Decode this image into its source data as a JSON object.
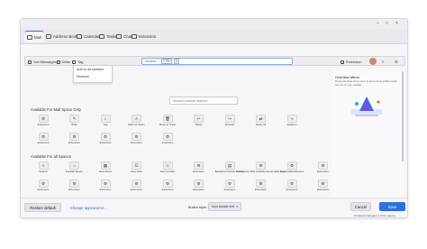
{
  "window_controls": [
    "–",
    "□",
    "×"
  ],
  "tabs": [
    {
      "label": "Mail",
      "icon": "mail-icon"
    },
    {
      "label": "Address Book",
      "icon": "address-book-icon"
    },
    {
      "label": "Calendar",
      "icon": "calendar-icon"
    },
    {
      "label": "Tasks",
      "icon": "tasks-icon"
    },
    {
      "label": "Chat",
      "icon": "chat-icon"
    },
    {
      "label": "Extension",
      "icon": "extension-icon"
    }
  ],
  "toolbar": {
    "get_messages": "Get Messages",
    "write": "Write",
    "tag": "Tag",
    "search_placeholder": "Search…",
    "shortcut_ctrl": "CTRL",
    "shortcut_key": "K",
    "extension": "Extension"
  },
  "context_menu": [
    "Add to all toolbars",
    "Remove"
  ],
  "palette": {
    "search_placeholder": "Search toolbar buttons…",
    "section_mail": "Available For Mail Space Only",
    "mail_row1": [
      {
        "label": "Extension",
        "glyph": "⚙"
      },
      {
        "label": "Write",
        "glyph": "✎"
      },
      {
        "label": "Tag",
        "glyph": "⌂"
      },
      {
        "label": "Mark as Spam",
        "glyph": "⚠"
      },
      {
        "label": "Move to Trash",
        "glyph": "🗑"
      },
      {
        "label": "Reply",
        "glyph": "↩"
      },
      {
        "label": "Forward",
        "glyph": "↪"
      },
      {
        "label": "Reply All",
        "glyph": "⇄"
      },
      {
        "label": "Redirect",
        "glyph": "⤷"
      }
    ],
    "mail_row2": [
      {
        "label": "Extension",
        "glyph": "⚙"
      },
      {
        "label": "Extension",
        "glyph": "⚙"
      },
      {
        "label": "Extension",
        "glyph": "⚙"
      },
      {
        "label": "Extension",
        "glyph": "⚙"
      },
      {
        "label": "Extension",
        "glyph": "⚙"
      }
    ],
    "section_all": "Available For all Spaces",
    "all_row1": [
      {
        "label": "Search",
        "glyph": "⌕"
      },
      {
        "label": "Parallel Space",
        "glyph": "⇔"
      },
      {
        "label": "New Event",
        "glyph": "▦"
      },
      {
        "label": "New Task",
        "glyph": "☑"
      },
      {
        "label": "New Contact",
        "glyph": "☺"
      },
      {
        "label": "Extension",
        "glyph": "⚙"
      },
      {
        "label": "Betterbird Simple Toolbar",
        "glyph": "▤"
      },
      {
        "label": "Summarize With A Mobile Email Hello Free",
        "glyph": "⚙"
      },
      {
        "label": "ExportAsPlusNames",
        "glyph": "⚙"
      },
      {
        "label": "Extension",
        "glyph": "⚙"
      }
    ],
    "all_row2": [
      {
        "label": "Extension",
        "glyph": "⚙"
      },
      {
        "label": "Extension",
        "glyph": "⚙"
      },
      {
        "label": "Extension",
        "glyph": "⚙"
      },
      {
        "label": "Extension",
        "glyph": "⚙"
      },
      {
        "label": "Extension",
        "glyph": "⚙"
      },
      {
        "label": "Extension",
        "glyph": "⚙"
      },
      {
        "label": "Extension",
        "glyph": "⚙"
      },
      {
        "label": "Extension",
        "glyph": "⚙"
      },
      {
        "label": "Extension",
        "glyph": "⚙"
      },
      {
        "label": "Extension",
        "glyph": "⚙"
      }
    ]
  },
  "info_panel": {
    "title": "Overflow Menu",
    "text": "Drag and drop items here to keep them within reach but out of your toolbar…"
  },
  "footer": {
    "restore": "Restore default",
    "change_appearance": "Change appearance…",
    "button_style_label": "Button style:",
    "button_style_value": "Icon beside text",
    "cancel": "Cancel",
    "save": "Save",
    "note": "Unsaved Changes in other spaces"
  },
  "colors": {
    "accent": "#2f6fe0",
    "background": "#f6f6f8"
  }
}
